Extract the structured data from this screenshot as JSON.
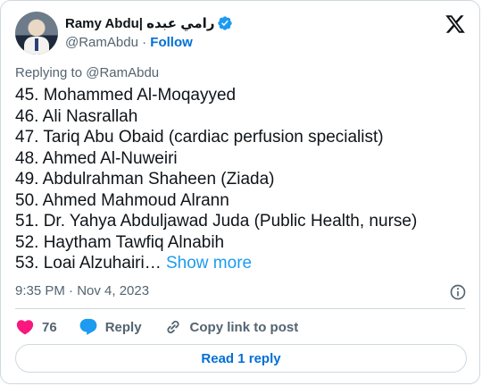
{
  "author": {
    "display_name": "Ramy Abdu| رامي عبده",
    "handle": "@RamAbdu",
    "separator": "·",
    "follow_label": "Follow"
  },
  "reply_context": "Replying to @RamAbdu",
  "body": {
    "lines": [
      "45. Mohammed Al-Moqayyed",
      "46. Ali Nasrallah",
      "47. Tariq Abu Obaid (cardiac perfusion specialist)",
      "48. Ahmed Al-Nuweiri",
      "49. Abdulrahman Shaheen (Ziada)",
      "50. Ahmed Mahmoud Alrann",
      "51. Dr. Yahya Abduljawad Juda (Public Health, nurse)",
      "52. Haytham Tawfiq Alnabih"
    ],
    "last_line_text": "53. Loai Alzuhairi…",
    "show_more_label": "Show more"
  },
  "timestamp": "9:35 PM · Nov 4, 2023",
  "actions": {
    "likes_count": "76",
    "reply_label": "Reply",
    "copy_link_label": "Copy link to post"
  },
  "read_reply_label": "Read 1 reply",
  "icons": {
    "verified": "verified-badge-icon",
    "x_logo": "x-logo-icon",
    "info": "info-icon",
    "like": "heart-icon",
    "reply": "speech-bubble-icon",
    "copy": "link-icon"
  },
  "colors": {
    "like": "#f91880",
    "reply": "#1d9bf0",
    "link": "#006fd6",
    "secondary_text": "#536471",
    "border": "#cfd9de"
  }
}
